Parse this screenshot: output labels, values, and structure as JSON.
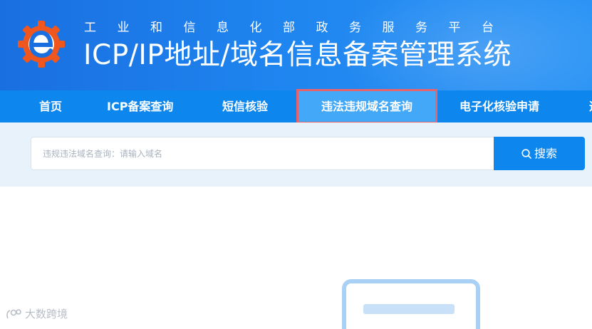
{
  "header": {
    "subtitle": "工业和信息化部政务服务平台",
    "title": "ICP/IP地址/域名信息备案管理系统",
    "logo_icon": "gear-e-logo",
    "colors": {
      "header_blue": "#1f86f0",
      "logo_orange": "#f0571f"
    }
  },
  "nav": {
    "items": [
      {
        "label": "首页"
      },
      {
        "label": "ICP备案查询"
      },
      {
        "label": "短信核验"
      },
      {
        "label": "违法违规域名查询"
      },
      {
        "label": "电子化核验申请"
      },
      {
        "label": "违"
      }
    ],
    "active_index": 3,
    "colors": {
      "nav_bg": "#0d86ee",
      "active_bg": "#42a8f7",
      "highlight_border": "#e8646c"
    }
  },
  "search": {
    "placeholder": "违规违法域名查询：请输入域名",
    "value": "",
    "button_label": "搜索",
    "button_icon": "search-icon"
  },
  "watermark": {
    "text": "大数跨境",
    "icon": "brand-logo-icon"
  }
}
